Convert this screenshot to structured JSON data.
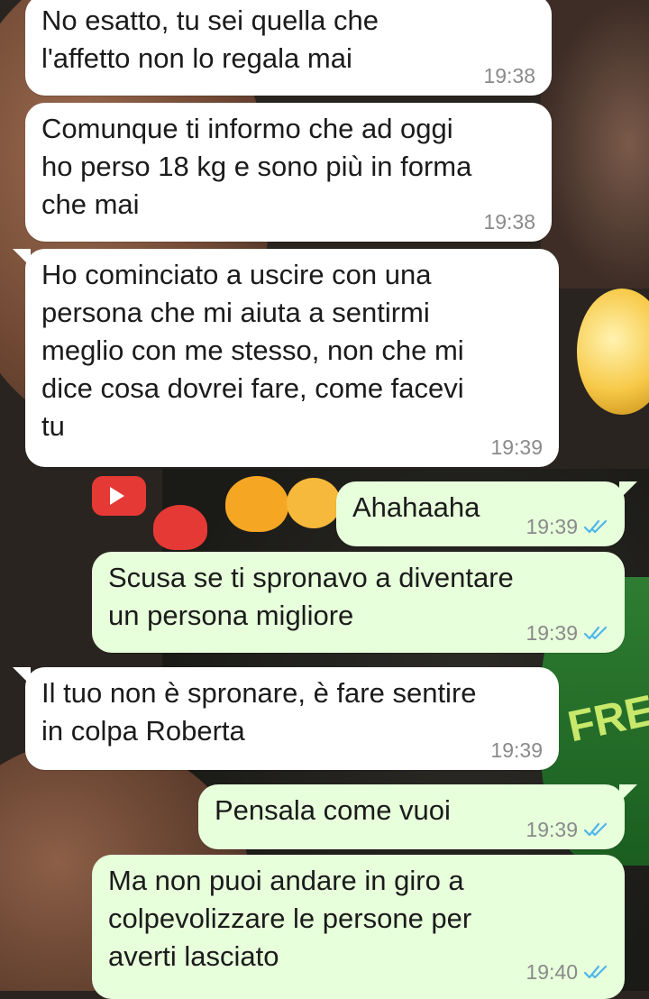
{
  "messages": [
    {
      "direction": "incoming",
      "text": "No esatto, tu sei quella che\nl'affetto non lo regala mai",
      "time": "19:38"
    },
    {
      "direction": "incoming",
      "text": "Comunque ti informo che ad oggi\nho perso 18 kg e sono più in forma\nche mai",
      "time": "19:38"
    },
    {
      "direction": "incoming",
      "text": "Ho cominciato a uscire con una\npersona che mi aiuta a sentirmi\nmeglio con me stesso, non che mi\ndice cosa dovrei fare, come facevi\ntu",
      "time": "19:39"
    },
    {
      "direction": "outgoing",
      "text": "Ahahaaha",
      "time": "19:39",
      "status": "read"
    },
    {
      "direction": "outgoing",
      "text": "Scusa se ti spronavo a diventare\nun persona migliore",
      "time": "19:39",
      "status": "read"
    },
    {
      "direction": "incoming",
      "text": "Il tuo non è spronare, è fare sentire\nin colpa Roberta",
      "time": "19:39"
    },
    {
      "direction": "outgoing",
      "text": "Pensala come vuoi",
      "time": "19:39",
      "status": "read"
    },
    {
      "direction": "outgoing",
      "text": "Ma non puoi andare in giro a\ncolpevolizzare le persone per\naverti lasciato",
      "time": "19:40",
      "status": "read"
    }
  ],
  "colors": {
    "incoming_bubble": "#ffffff",
    "outgoing_bubble": "#e7ffdb",
    "read_ticks": "#4fb6ec",
    "timestamp": "#8a8a8a"
  },
  "icons": {
    "read_status": "double-check-icon"
  },
  "wallpaper": {
    "text": "FRE"
  }
}
